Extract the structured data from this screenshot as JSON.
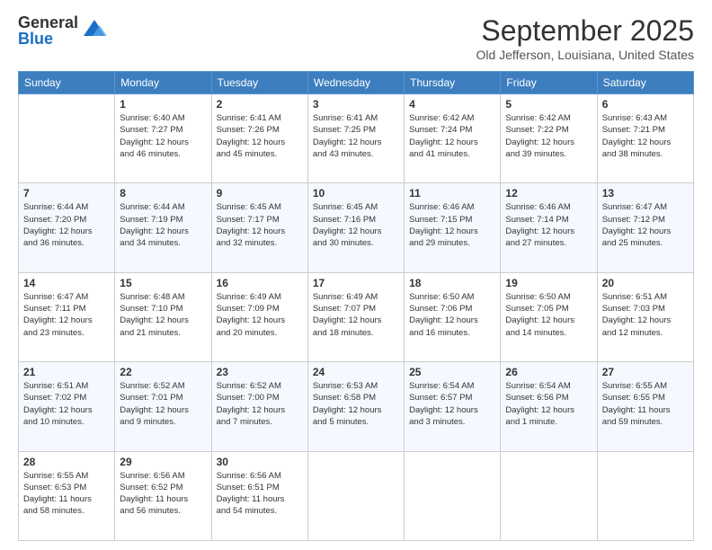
{
  "logo": {
    "general": "General",
    "blue": "Blue"
  },
  "title": "September 2025",
  "location": "Old Jefferson, Louisiana, United States",
  "headers": [
    "Sunday",
    "Monday",
    "Tuesday",
    "Wednesday",
    "Thursday",
    "Friday",
    "Saturday"
  ],
  "weeks": [
    [
      {
        "day": "",
        "info": ""
      },
      {
        "day": "1",
        "info": "Sunrise: 6:40 AM\nSunset: 7:27 PM\nDaylight: 12 hours\nand 46 minutes."
      },
      {
        "day": "2",
        "info": "Sunrise: 6:41 AM\nSunset: 7:26 PM\nDaylight: 12 hours\nand 45 minutes."
      },
      {
        "day": "3",
        "info": "Sunrise: 6:41 AM\nSunset: 7:25 PM\nDaylight: 12 hours\nand 43 minutes."
      },
      {
        "day": "4",
        "info": "Sunrise: 6:42 AM\nSunset: 7:24 PM\nDaylight: 12 hours\nand 41 minutes."
      },
      {
        "day": "5",
        "info": "Sunrise: 6:42 AM\nSunset: 7:22 PM\nDaylight: 12 hours\nand 39 minutes."
      },
      {
        "day": "6",
        "info": "Sunrise: 6:43 AM\nSunset: 7:21 PM\nDaylight: 12 hours\nand 38 minutes."
      }
    ],
    [
      {
        "day": "7",
        "info": "Sunrise: 6:44 AM\nSunset: 7:20 PM\nDaylight: 12 hours\nand 36 minutes."
      },
      {
        "day": "8",
        "info": "Sunrise: 6:44 AM\nSunset: 7:19 PM\nDaylight: 12 hours\nand 34 minutes."
      },
      {
        "day": "9",
        "info": "Sunrise: 6:45 AM\nSunset: 7:17 PM\nDaylight: 12 hours\nand 32 minutes."
      },
      {
        "day": "10",
        "info": "Sunrise: 6:45 AM\nSunset: 7:16 PM\nDaylight: 12 hours\nand 30 minutes."
      },
      {
        "day": "11",
        "info": "Sunrise: 6:46 AM\nSunset: 7:15 PM\nDaylight: 12 hours\nand 29 minutes."
      },
      {
        "day": "12",
        "info": "Sunrise: 6:46 AM\nSunset: 7:14 PM\nDaylight: 12 hours\nand 27 minutes."
      },
      {
        "day": "13",
        "info": "Sunrise: 6:47 AM\nSunset: 7:12 PM\nDaylight: 12 hours\nand 25 minutes."
      }
    ],
    [
      {
        "day": "14",
        "info": "Sunrise: 6:47 AM\nSunset: 7:11 PM\nDaylight: 12 hours\nand 23 minutes."
      },
      {
        "day": "15",
        "info": "Sunrise: 6:48 AM\nSunset: 7:10 PM\nDaylight: 12 hours\nand 21 minutes."
      },
      {
        "day": "16",
        "info": "Sunrise: 6:49 AM\nSunset: 7:09 PM\nDaylight: 12 hours\nand 20 minutes."
      },
      {
        "day": "17",
        "info": "Sunrise: 6:49 AM\nSunset: 7:07 PM\nDaylight: 12 hours\nand 18 minutes."
      },
      {
        "day": "18",
        "info": "Sunrise: 6:50 AM\nSunset: 7:06 PM\nDaylight: 12 hours\nand 16 minutes."
      },
      {
        "day": "19",
        "info": "Sunrise: 6:50 AM\nSunset: 7:05 PM\nDaylight: 12 hours\nand 14 minutes."
      },
      {
        "day": "20",
        "info": "Sunrise: 6:51 AM\nSunset: 7:03 PM\nDaylight: 12 hours\nand 12 minutes."
      }
    ],
    [
      {
        "day": "21",
        "info": "Sunrise: 6:51 AM\nSunset: 7:02 PM\nDaylight: 12 hours\nand 10 minutes."
      },
      {
        "day": "22",
        "info": "Sunrise: 6:52 AM\nSunset: 7:01 PM\nDaylight: 12 hours\nand 9 minutes."
      },
      {
        "day": "23",
        "info": "Sunrise: 6:52 AM\nSunset: 7:00 PM\nDaylight: 12 hours\nand 7 minutes."
      },
      {
        "day": "24",
        "info": "Sunrise: 6:53 AM\nSunset: 6:58 PM\nDaylight: 12 hours\nand 5 minutes."
      },
      {
        "day": "25",
        "info": "Sunrise: 6:54 AM\nSunset: 6:57 PM\nDaylight: 12 hours\nand 3 minutes."
      },
      {
        "day": "26",
        "info": "Sunrise: 6:54 AM\nSunset: 6:56 PM\nDaylight: 12 hours\nand 1 minute."
      },
      {
        "day": "27",
        "info": "Sunrise: 6:55 AM\nSunset: 6:55 PM\nDaylight: 11 hours\nand 59 minutes."
      }
    ],
    [
      {
        "day": "28",
        "info": "Sunrise: 6:55 AM\nSunset: 6:53 PM\nDaylight: 11 hours\nand 58 minutes."
      },
      {
        "day": "29",
        "info": "Sunrise: 6:56 AM\nSunset: 6:52 PM\nDaylight: 11 hours\nand 56 minutes."
      },
      {
        "day": "30",
        "info": "Sunrise: 6:56 AM\nSunset: 6:51 PM\nDaylight: 11 hours\nand 54 minutes."
      },
      {
        "day": "",
        "info": ""
      },
      {
        "day": "",
        "info": ""
      },
      {
        "day": "",
        "info": ""
      },
      {
        "day": "",
        "info": ""
      }
    ]
  ]
}
